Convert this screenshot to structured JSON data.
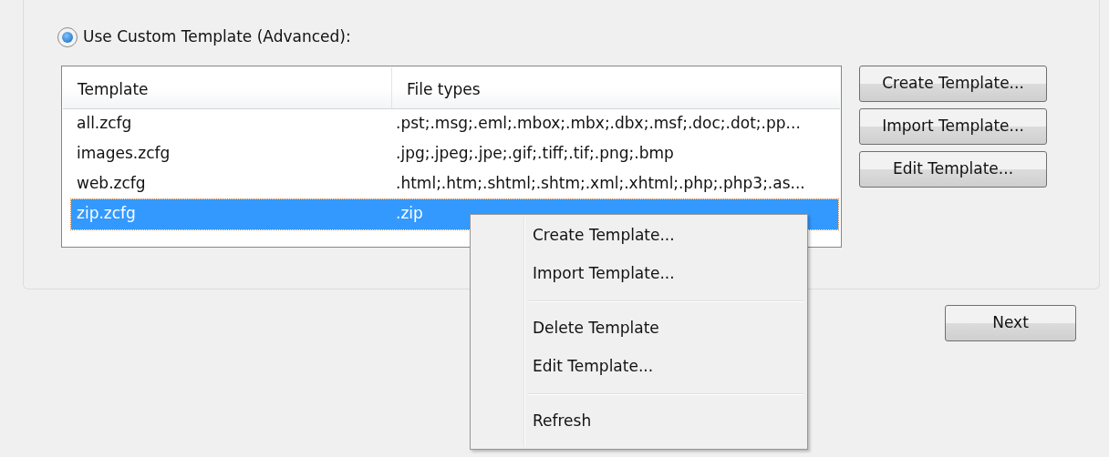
{
  "radio": {
    "label": "Use Custom Template (Advanced):",
    "selected": true
  },
  "table": {
    "columns": [
      "Template",
      "File types"
    ],
    "rows": [
      {
        "cells": [
          "all.zcfg",
          ".pst;.msg;.eml;.mbox;.mbx;.dbx;.msf;.doc;.dot;.pp..."
        ],
        "selected": false
      },
      {
        "cells": [
          "images.zcfg",
          ".jpg;.jpeg;.jpe;.gif;.tiff;.tif;.png;.bmp"
        ],
        "selected": false
      },
      {
        "cells": [
          "web.zcfg",
          ".html;.htm;.shtml;.shtm;.xml;.xhtml;.php;.php3;.as..."
        ],
        "selected": false
      },
      {
        "cells": [
          "zip.zcfg",
          ".zip"
        ],
        "selected": true
      }
    ]
  },
  "side_buttons": [
    "Create Template...",
    "Import Template...",
    "Edit Template..."
  ],
  "context_menu": {
    "items": [
      {
        "kind": "item",
        "label": "Create Template..."
      },
      {
        "kind": "item",
        "label": "Import Template..."
      },
      {
        "kind": "separator"
      },
      {
        "kind": "item",
        "label": "Delete Template"
      },
      {
        "kind": "item",
        "label": "Edit Template..."
      },
      {
        "kind": "separator"
      },
      {
        "kind": "item",
        "label": "Refresh"
      }
    ]
  },
  "next_button": "Next"
}
